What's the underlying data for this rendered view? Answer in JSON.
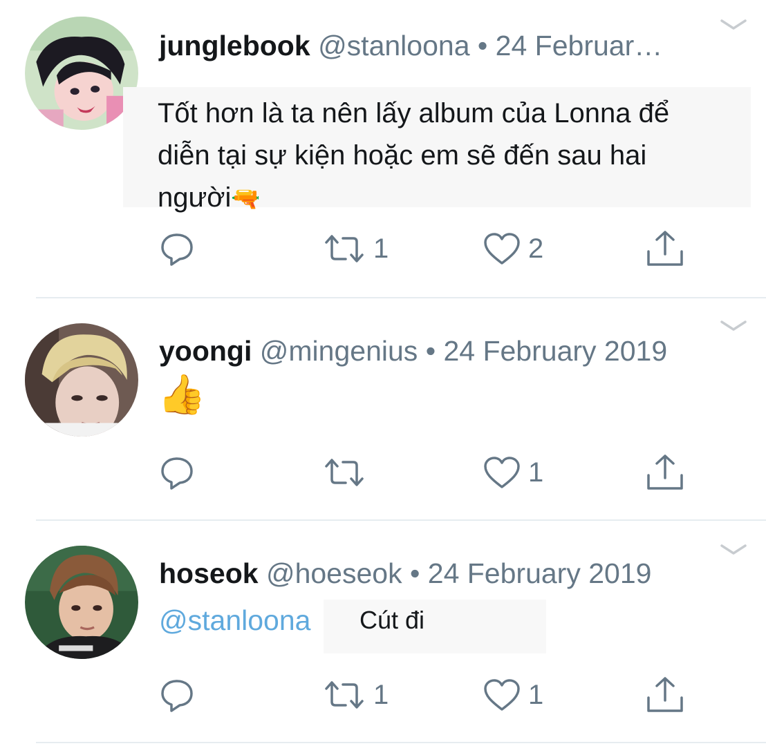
{
  "colors": {
    "text": "#14171a",
    "secondary": "#657786",
    "link": "#5fa9dd",
    "divider": "#e6ecf0"
  },
  "tweets": [
    {
      "name": "junglebook",
      "handle": "@stanloona",
      "separator": "•",
      "date": "24 Februar…",
      "text_lines": [
        "Tốt hơn là ta nên lấy album của Lonna để",
        "diễn tại sự kiện hoặc em sẽ đến sau hai",
        "người"
      ],
      "emoji": "🔫",
      "reply_count": "",
      "retweet_count": "1",
      "like_count": "2",
      "icons": [
        "chevron-down-icon",
        "reply-icon",
        "retweet-icon",
        "heart-icon",
        "share-icon"
      ]
    },
    {
      "name": "yoongi",
      "handle": "@mingenius",
      "separator": "•",
      "date": "24 February 2019",
      "emoji": "👍",
      "reply_count": "",
      "retweet_count": "",
      "like_count": "1",
      "icons": [
        "chevron-down-icon",
        "reply-icon",
        "retweet-icon",
        "heart-icon",
        "share-icon"
      ]
    },
    {
      "name": "hoseok",
      "handle": "@hoeseok",
      "separator": "•",
      "date": "24 February 2019",
      "mention": "@stanloona",
      "text": "Cút đi",
      "reply_count": "",
      "retweet_count": "1",
      "like_count": "1",
      "icons": [
        "chevron-down-icon",
        "reply-icon",
        "retweet-icon",
        "heart-icon",
        "share-icon"
      ]
    }
  ]
}
